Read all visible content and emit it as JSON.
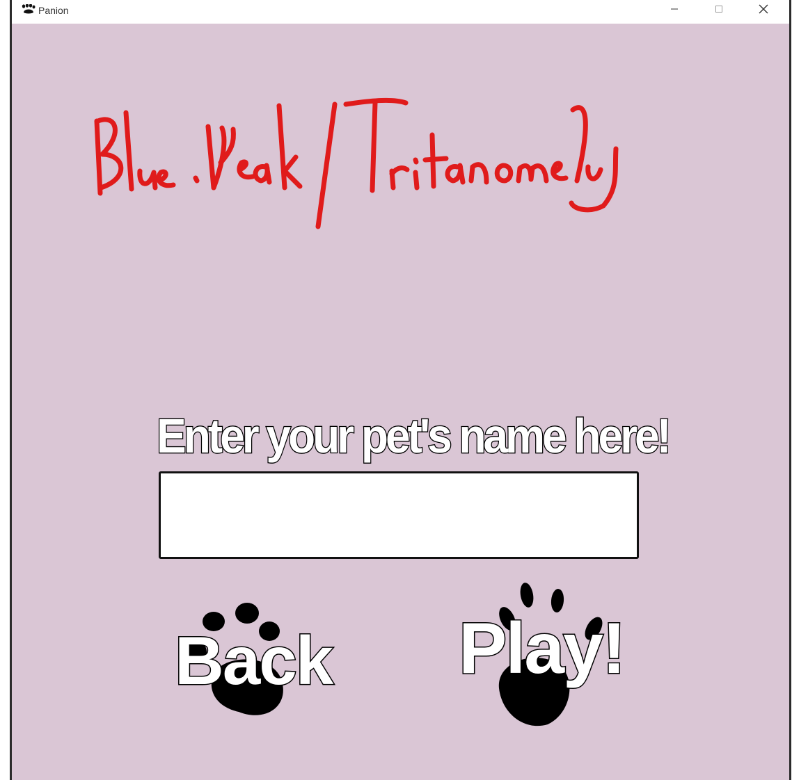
{
  "window": {
    "title": "Panion",
    "app_icon": "paw-icon",
    "controls": {
      "minimize_icon": "minimize-icon",
      "maximize_icon": "maximize-icon",
      "close_icon": "close-icon"
    }
  },
  "annotation": {
    "text": "Blue.Weak/Tritanomaly",
    "color": "#e01b1b"
  },
  "main": {
    "prompt": "Enter your pet's name here!",
    "name_input": {
      "value": "",
      "placeholder": ""
    },
    "back_button": {
      "label": "Back",
      "icon": "paw-print-icon"
    },
    "play_button": {
      "label": "Play!",
      "icon": "paw-print-icon"
    }
  },
  "colors": {
    "background": "#dac6d5",
    "annotation": "#e01b1b",
    "paw": "#000000"
  }
}
